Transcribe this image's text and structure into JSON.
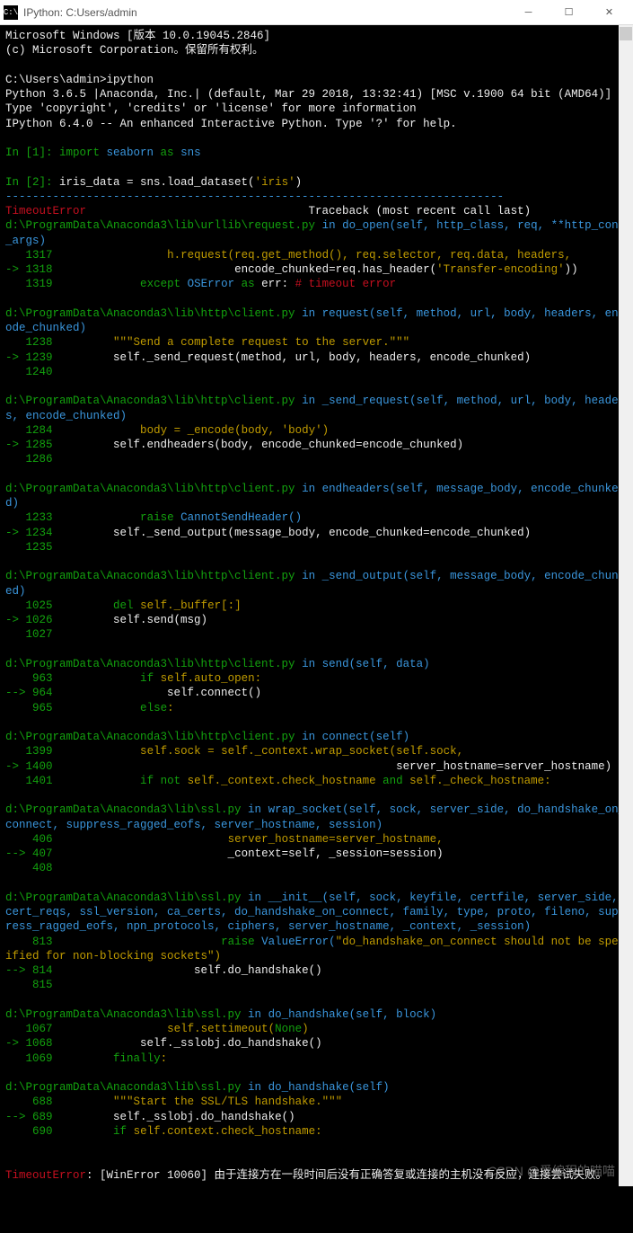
{
  "titlebar": {
    "icon_label": "C:\\",
    "title": "IPython: C:Users/admin"
  },
  "header": {
    "line1": "Microsoft Windows [版本 10.0.19045.2846]",
    "line2": "(c) Microsoft Corporation。保留所有权利。"
  },
  "prompt": {
    "path": "C:\\Users\\admin>",
    "command": "ipython"
  },
  "banner": {
    "line1": "Python 3.6.5 |Anaconda, Inc.| (default, Mar 29 2018, 13:32:41) [MSC v.1900 64 bit (AMD64)]",
    "line2": "Type 'copyright', 'credits' or 'license' for more information",
    "line3": "IPython 6.4.0 -- An enhanced Interactive Python. Type '?' for help."
  },
  "inputs": {
    "in1label": "In [1]: ",
    "in1_import": "import",
    "in1_mod": " seaborn ",
    "in1_as": "as",
    "in1_alias": " sns",
    "in2label": "In [2]: ",
    "in2_code1": "iris_data = sns.load_dataset(",
    "in2_str": "'iris'",
    "in2_code2": ")"
  },
  "sep": "--------------------------------------------------------------------------",
  "traceback": {
    "error_name": "TimeoutError",
    "header_rest": "                                 Traceback (most recent call last)"
  },
  "frames": [
    {
      "path": "d:\\ProgramData\\Anaconda3\\lib\\urllib\\request.py",
      "in": " in ",
      "func": "do_open(self, http_class, req, **http_conn_args)",
      "lines": [
        {
          "no": "   1317",
          "arrow": "  ",
          "body_w": "                h.request(req.get_method(), req.selector, req.data, headers,"
        },
        {
          "no": "-> 1318",
          "arrow": "",
          "body_w": "                          encode_chunked=req.has_header(",
          "str": "'Transfer-encoding'",
          "tail": "))"
        },
        {
          "no": "   1319",
          "arrow": "  ",
          "kw": "            except ",
          "cls": "OSError ",
          "kw2": "as ",
          "var": "err: ",
          "cmt": "# timeout error"
        }
      ]
    },
    {
      "path": "d:\\ProgramData\\Anaconda3\\lib\\http\\client.py",
      "in": " in ",
      "func": "request(self, method, url, body, headers, encode_chunked)",
      "lines": [
        {
          "no": "   1238",
          "doc": "        \"\"\"Send a complete request to the server.\"\"\""
        },
        {
          "no": "-> 1239",
          "body_w": "        self._send_request(method, url, body, headers, encode_chunked)"
        },
        {
          "no": "   1240",
          "body_w": ""
        }
      ]
    },
    {
      "path": "d:\\ProgramData\\Anaconda3\\lib\\http\\client.py",
      "in": " in ",
      "func": "_send_request(self, method, url, body, headers, encode_chunked)",
      "lines": [
        {
          "no": "   1284",
          "body_w": "            body = _encode(body, ",
          "str": "'body'",
          "tail": ")"
        },
        {
          "no": "-> 1285",
          "body_w": "        self.endheaders(body, encode_chunked=encode_chunked)"
        },
        {
          "no": "   1286",
          "body_w": ""
        }
      ]
    },
    {
      "path": "d:\\ProgramData\\Anaconda3\\lib\\http\\client.py",
      "in": " in ",
      "func": "endheaders(self, message_body, encode_chunked)",
      "lines": [
        {
          "no": "   1233",
          "kw": "            raise ",
          "cls": "CannotSendHeader()"
        },
        {
          "no": "-> 1234",
          "body_w": "        self._send_output(message_body, encode_chunked=encode_chunked)"
        },
        {
          "no": "   1235",
          "body_w": ""
        }
      ]
    },
    {
      "path": "d:\\ProgramData\\Anaconda3\\lib\\http\\client.py",
      "in": " in ",
      "func": "_send_output(self, message_body, encode_chunked)",
      "lines": [
        {
          "no": "   1025",
          "kw": "        del ",
          "body_w": "self._buffer[:]"
        },
        {
          "no": "-> 1026",
          "body_w": "        self.send(msg)"
        },
        {
          "no": "   1027",
          "body_w": ""
        }
      ]
    },
    {
      "path": "d:\\ProgramData\\Anaconda3\\lib\\http\\client.py",
      "in": " in ",
      "func": "send(self, data)",
      "lines": [
        {
          "no": "    963",
          "kw": "            if ",
          "body_w": "self.auto_open:"
        },
        {
          "no": "--> 964",
          "body_w": "                self.connect()"
        },
        {
          "no": "    965",
          "kw": "            else",
          "body_w": ":"
        }
      ]
    },
    {
      "path": "d:\\ProgramData\\Anaconda3\\lib\\http\\client.py",
      "in": " in ",
      "func": "connect(self)",
      "lines": [
        {
          "no": "   1399",
          "body_w": "            self.sock = self._context.wrap_socket(self.sock,"
        },
        {
          "no": "-> 1400",
          "body_w": "                                                  server_hostname=server_hostname)"
        },
        {
          "no": "   1401",
          "kw": "            if not ",
          "body_w": "self._context.check_hostname ",
          "kw2": "and ",
          "tail_w": "self._check_hostname:"
        }
      ]
    },
    {
      "path": "d:\\ProgramData\\Anaconda3\\lib\\ssl.py",
      "in": " in ",
      "func": "wrap_socket(self, sock, server_side, do_handshake_on_connect, suppress_ragged_eofs, server_hostname, session)",
      "lines": [
        {
          "no": "    406",
          "body_w": "                         server_hostname=server_hostname,"
        },
        {
          "no": "--> 407",
          "body_w": "                         _context=self, _session=session)"
        },
        {
          "no": "    408",
          "body_w": ""
        }
      ]
    },
    {
      "path": "d:\\ProgramData\\Anaconda3\\lib\\ssl.py",
      "in": " in ",
      "func": "__init__(self, sock, keyfile, certfile, server_side, cert_reqs, ssl_version, ca_certs, do_handshake_on_connect, family, type, proto, fileno, suppress_ragged_eofs, npn_protocols, ciphers, server_hostname, _context, _session)",
      "lines": [
        {
          "no": "    813",
          "kw": "                        raise ",
          "cls": "ValueError(",
          "str": "\"do_handshake_on_connect should not be specified for non-blocking sockets\"",
          "tail": ")"
        },
        {
          "no": "--> 814",
          "body_w": "                    self.do_handshake()"
        },
        {
          "no": "    815",
          "body_w": ""
        }
      ]
    },
    {
      "path": "d:\\ProgramData\\Anaconda3\\lib\\ssl.py",
      "in": " in ",
      "func": "do_handshake(self, block)",
      "lines": [
        {
          "no": "   1067",
          "body_w": "                self.settimeout(",
          "kw2": "None",
          "tail": ")"
        },
        {
          "no": "-> 1068",
          "body_w": "            self._sslobj.do_handshake()"
        },
        {
          "no": "   1069",
          "kw": "        finally",
          "body_w": ":"
        }
      ]
    },
    {
      "path": "d:\\ProgramData\\Anaconda3\\lib\\ssl.py",
      "in": " in ",
      "func": "do_handshake(self)",
      "lines": [
        {
          "no": "    688",
          "doc": "        \"\"\"Start the SSL/TLS handshake.\"\"\""
        },
        {
          "no": "--> 689",
          "body_w": "        self._sslobj.do_handshake()"
        },
        {
          "no": "    690",
          "kw": "        if ",
          "body_w": "self.context.check_hostname:"
        }
      ]
    }
  ],
  "final_error": {
    "name": "TimeoutError",
    "msg": ": [WinError 10060] 由于连接方在一段时间后没有正确答复或连接的主机没有反应，连接尝试失败。"
  },
  "watermark": "CSDN @爱编程的喵喵"
}
